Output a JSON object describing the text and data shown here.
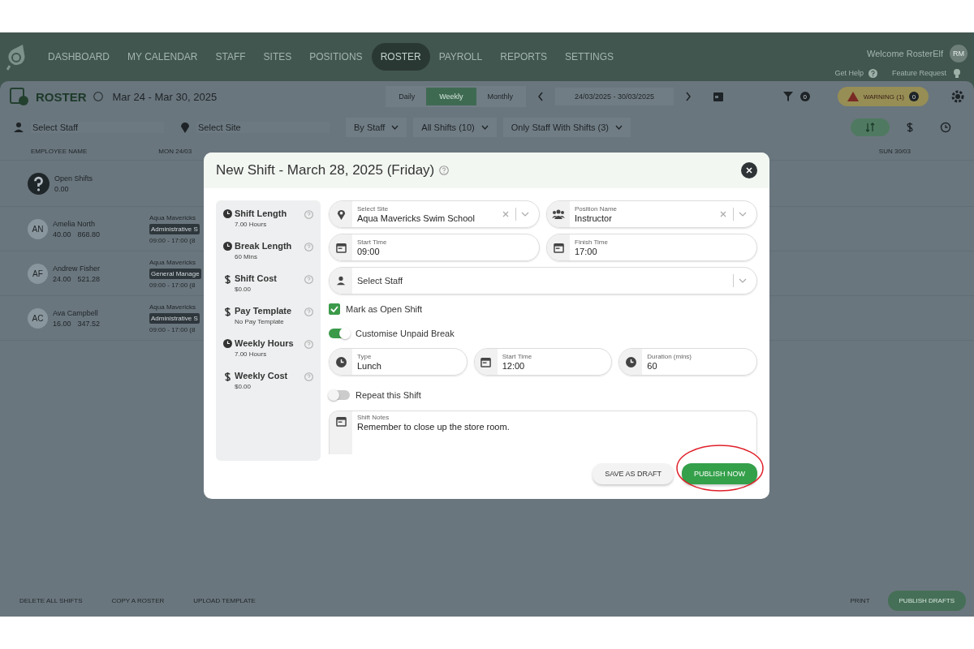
{
  "nav": {
    "items": [
      {
        "label": "DASHBOARD",
        "selected": false
      },
      {
        "label": "MY CALENDAR",
        "selected": false
      },
      {
        "label": "STAFF",
        "selected": false
      },
      {
        "label": "SITES",
        "selected": false
      },
      {
        "label": "POSITIONS",
        "selected": false
      },
      {
        "label": "ROSTER",
        "selected": true
      },
      {
        "label": "PAYROLL",
        "selected": false
      },
      {
        "label": "REPORTS",
        "selected": false
      },
      {
        "label": "SETTINGS",
        "selected": false
      }
    ],
    "welcome": "Welcome RosterElf",
    "avatar": "RM",
    "help": "Get Help",
    "feature": "Feature Request"
  },
  "toolbar": {
    "title": "ROSTER",
    "range": "Mar 24 - Mar 30, 2025",
    "views": [
      {
        "label": "Daily",
        "selected": false
      },
      {
        "label": "Weekly",
        "selected": true
      },
      {
        "label": "Monthly",
        "selected": false
      }
    ],
    "dates": "24/03/2025 - 30/03/2025",
    "filter_count": "0",
    "warning": "WARNING (1)",
    "warning_count": "0"
  },
  "filters": {
    "staff_placeholder": "Select Staff",
    "site_placeholder": "Select Site",
    "group": "By Staff",
    "shifts": "All Shifts (10)",
    "visibility": "Only Staff With Shifts (3)"
  },
  "table": {
    "columns": [
      "EMPLOYEE NAME",
      "MON 24/03",
      "SUN 30/03"
    ],
    "open_row": {
      "name": "Open Shifts",
      "hours": "0.00"
    },
    "rows": [
      {
        "initials": "AN",
        "name": "Amelia North",
        "hours": "40.00",
        "cost": "868.80",
        "site": "Aqua Mavericks",
        "position": "Administrative S",
        "time": "09:00 - 17:00 (8"
      },
      {
        "initials": "AF",
        "name": "Andrew Fisher",
        "hours": "24.00",
        "cost": "521.28",
        "site": "Aqua Mavericks",
        "position": "General Manage",
        "time": "09:00 - 17:00 (8"
      },
      {
        "initials": "AC",
        "name": "Ava Campbell",
        "hours": "16.00",
        "cost": "347.52",
        "site": "Aqua Mavericks",
        "position": "Administrative S",
        "time": "09:00 - 17:00 (8"
      }
    ]
  },
  "bottom_bar": {
    "left": [
      "DELETE ALL SHIFTS",
      "COPY A ROSTER",
      "UPLOAD TEMPLATE"
    ],
    "print": "PRINT",
    "publish": "PUBLISH DRAFTS"
  },
  "modal": {
    "title": "New Shift - March 28, 2025 (Friday)",
    "summary": [
      {
        "kind": "clock",
        "label": "Shift Length",
        "value": "7.00 Hours"
      },
      {
        "kind": "clock",
        "label": "Break Length",
        "value": "60 Mins"
      },
      {
        "kind": "dollar",
        "label": "Shift Cost",
        "value": "$0.00"
      },
      {
        "kind": "dollar",
        "label": "Pay Template",
        "value": "No Pay Template"
      },
      {
        "kind": "clock",
        "label": "Weekly Hours",
        "value": "7.00 Hours"
      },
      {
        "kind": "dollar",
        "label": "Weekly Cost",
        "value": "$0.00"
      }
    ],
    "site": {
      "label": "Select Site",
      "value": "Aqua Mavericks Swim School"
    },
    "position": {
      "label": "Position Name",
      "value": "Instructor"
    },
    "start": {
      "label": "Start Time",
      "value": "09:00"
    },
    "finish": {
      "label": "Finish Time",
      "value": "17:00"
    },
    "staff": {
      "placeholder": "Select Staff"
    },
    "open_shift": {
      "label": "Mark as Open Shift",
      "checked": true
    },
    "unpaid_break": {
      "label": "Customise Unpaid Break",
      "on": true
    },
    "break_type": {
      "label": "Type",
      "value": "Lunch"
    },
    "break_start": {
      "label": "Start Time",
      "value": "12:00"
    },
    "break_duration": {
      "label": "Duration (mins)",
      "value": "60"
    },
    "repeat": {
      "label": "Repeat this Shift",
      "on": false
    },
    "notes": {
      "label": "Shift Notes",
      "value": "Remember to close up the store room."
    },
    "buttons": {
      "draft": "SAVE AS DRAFT",
      "publish": "PUBLISH NOW"
    }
  }
}
